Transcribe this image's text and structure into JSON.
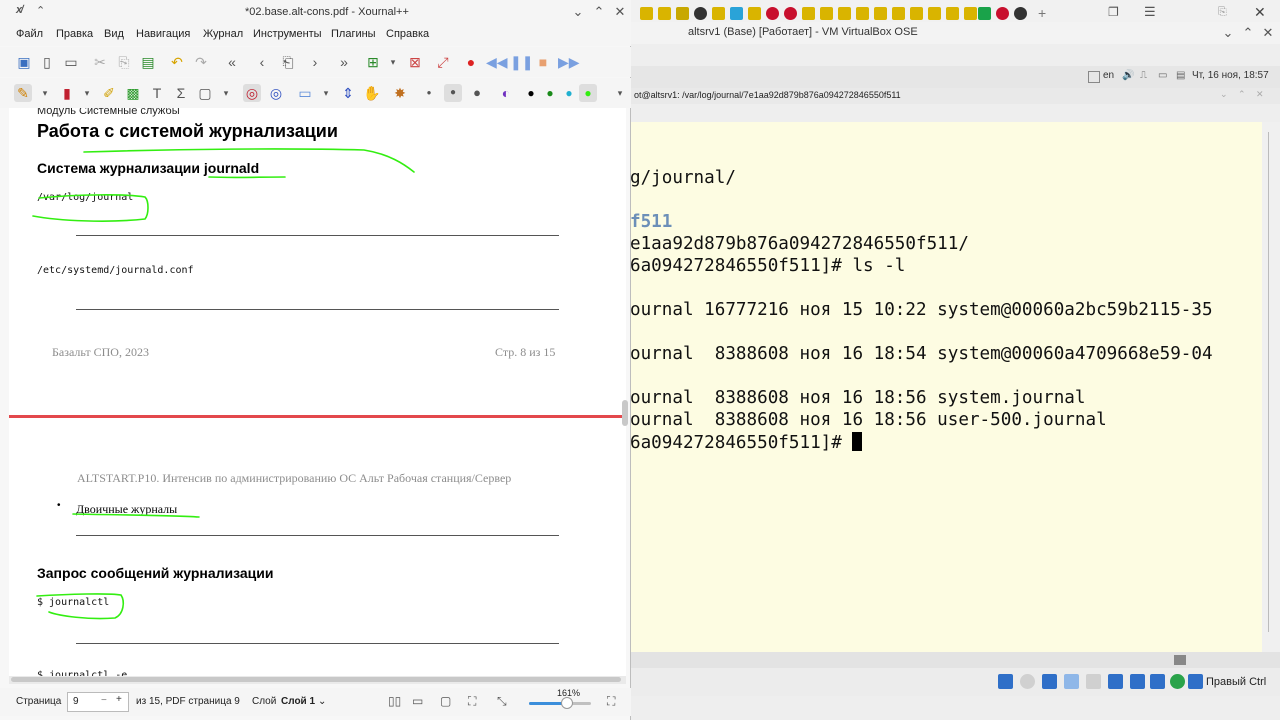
{
  "xournal": {
    "title": "*02.base.alt-cons.pdf - Xournal++",
    "menu": [
      "Файл",
      "Правка",
      "Вид",
      "Навигация",
      "Журнал",
      "Инструменты",
      "Плагины",
      "Справка"
    ],
    "page1": {
      "header": "Модуль Системные службы",
      "heading": "Работа с системой журнализации",
      "subheading": "Система журнализации journald",
      "code1": "/var/log/journal",
      "code2": "/etc/systemd/journald.conf",
      "footer_left": "Базальт СПО, 2023",
      "footer_right": "Стр. 8   из 15"
    },
    "page2": {
      "header": "ALTSTART.P10. Интенсив по администрированию ОС Альт Рабочая станция/Сервер",
      "bullet": "Двоичные журналы",
      "heading": "Запрос сообщений журнализации",
      "code1": "$ journalctl",
      "code2": "$ journalctl -e"
    },
    "status": {
      "page_label": "Страница",
      "page_value": "9",
      "page_of": "из 15, PDF страница 9",
      "layer_label": "Слой",
      "layer_value": "Слой 1",
      "zoom": "161%",
      "zoom_fraction": 0.62
    },
    "colors": {
      "ink": "#33ee11",
      "accent": "#3b8edb"
    }
  },
  "vbox": {
    "title": "altsrv1 (Base) [Работает] - VM VirtualBox OSE",
    "clock": "Чт, 16 ноя, 18:57",
    "lang": "en",
    "terminal_title": "ot@altsrv1: /var/log/journal/7e1aa92d879b876a094272846550f511",
    "terminal_lines": [
      "g/journal/",
      "f511",
      "e1aa92d879b876a094272846550f511/",
      "6a094272846550f511]# ls -l",
      "ournal 16777216 ноя 15 10:22 system@00060a2bc59b2115-35",
      "ournal  8388608 ноя 16 18:54 system@00060a4709668e59-04",
      "ournal  8388608 ноя 16 18:56 system.journal",
      "ournal  8388608 ноя 16 18:56 user-500.journal",
      "6a094272846550f511]# "
    ],
    "host_key": "Правый Ctrl"
  }
}
